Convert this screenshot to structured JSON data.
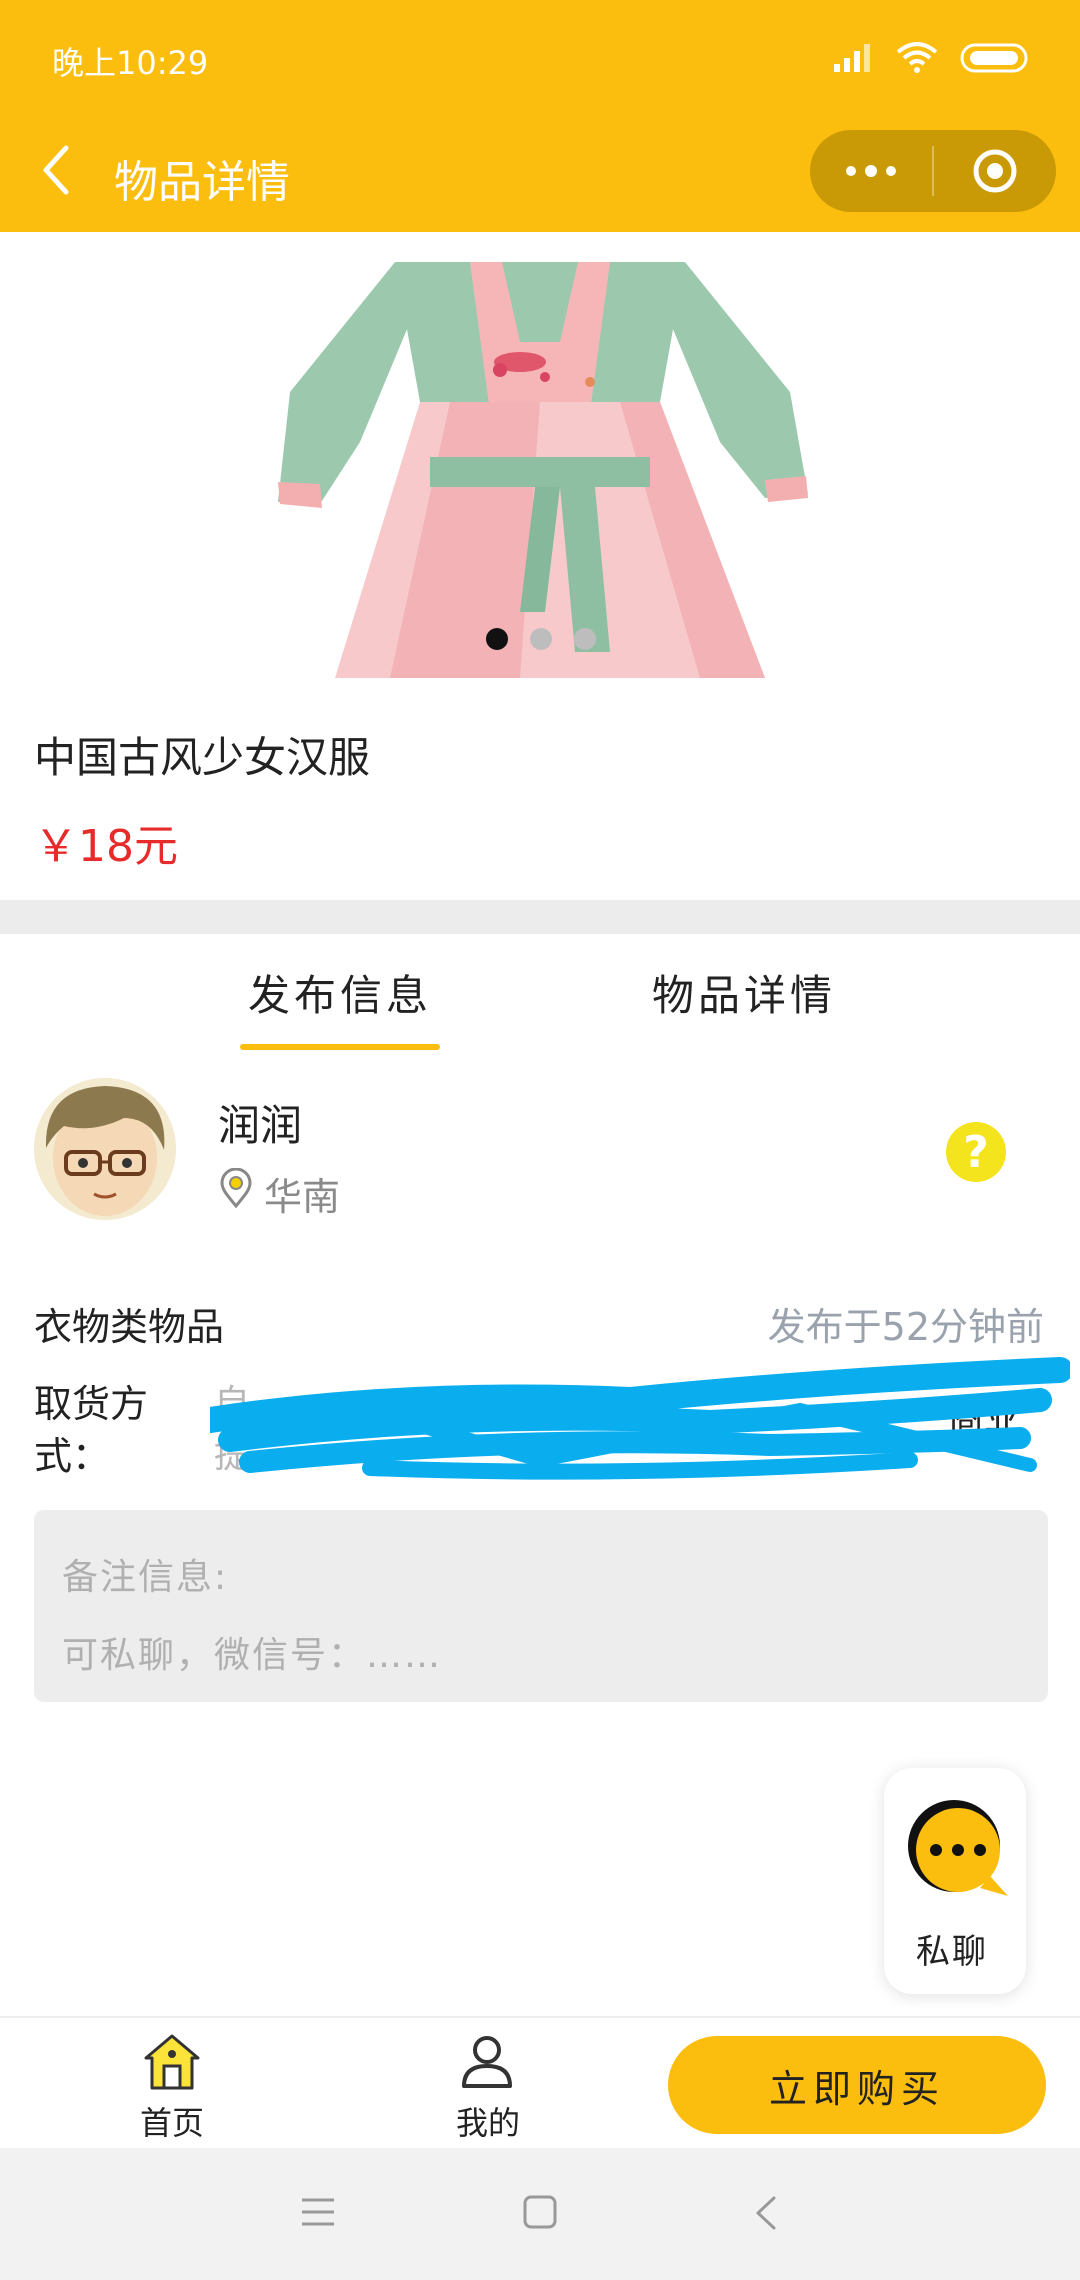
{
  "status_bar": {
    "time": "晚上10:29"
  },
  "nav": {
    "title": "物品详情"
  },
  "product": {
    "title": "中国古风少女汉服",
    "price": "￥18元",
    "image_icon": "hanfu-dress-image",
    "carousel": {
      "count": 3,
      "active_index": 0
    }
  },
  "tabs": [
    {
      "label": "发布信息",
      "active": true
    },
    {
      "label": "物品详情",
      "active": false
    }
  ],
  "seller": {
    "name": "润润",
    "location": "华南",
    "avatar_icon": "cartoon-boy-avatar"
  },
  "info": {
    "category": "衣物类物品",
    "post_time": "发布于52分钟前",
    "pickup_label": "取货方式：",
    "pickup_option": "自提",
    "pickup_extra": "商业"
  },
  "note": {
    "label": "备注信息:",
    "text": "可私聊，微信号：……"
  },
  "chat": {
    "label": "私聊"
  },
  "bottom_bar": {
    "home_label": "首页",
    "mine_label": "我的",
    "buy_label": "立即购买"
  },
  "colors": {
    "brand_yellow": "#FBBD0E",
    "price_red": "#E72B2B",
    "scribble_blue": "#0AAEEF"
  }
}
